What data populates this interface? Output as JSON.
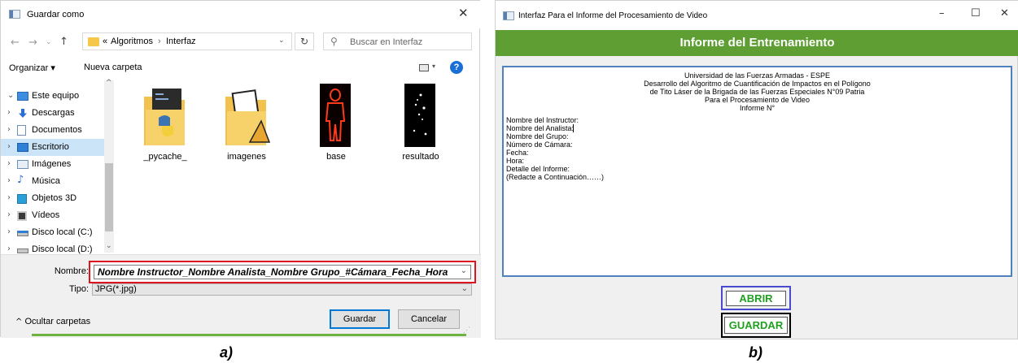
{
  "save_dialog": {
    "title": "Guardar como",
    "address": {
      "prefix": "«",
      "path1": "Algoritmos",
      "sep": "›",
      "path2": "Interfaz"
    },
    "search_placeholder": "Buscar en Interfaz",
    "toolbar": {
      "organize": "Organizar ▾",
      "new_folder": "Nueva carpeta"
    },
    "sidebar": [
      {
        "label": "Este equipo",
        "icon": "computer-icon",
        "chev": "⌄"
      },
      {
        "label": "Descargas",
        "icon": "download-icon",
        "chev": "›"
      },
      {
        "label": "Documentos",
        "icon": "documents-icon",
        "chev": "›"
      },
      {
        "label": "Escritorio",
        "icon": "desktop-icon",
        "chev": "›",
        "selected": true
      },
      {
        "label": "Imágenes",
        "icon": "pictures-icon",
        "chev": "›"
      },
      {
        "label": "Música",
        "icon": "music-icon",
        "chev": "›"
      },
      {
        "label": "Objetos 3D",
        "icon": "3d-objects-icon",
        "chev": "›"
      },
      {
        "label": "Vídeos",
        "icon": "videos-icon",
        "chev": "›"
      },
      {
        "label": "Disco local (C:)",
        "icon": "drive-c-icon",
        "chev": "›"
      },
      {
        "label": "Disco local (D:)",
        "icon": "drive-d-icon",
        "chev": "›"
      }
    ],
    "files": [
      {
        "name": "_pycache_",
        "icon": "python-folder-icon"
      },
      {
        "name": "imagenes",
        "icon": "images-folder-icon"
      },
      {
        "name": "base",
        "icon": "base-image-icon"
      },
      {
        "name": "resultado",
        "icon": "result-image-icon"
      }
    ],
    "name_label": "Nombre:",
    "name_value": "Nombre Instructor_Nombre Analista_Nombre Grupo_#Cámara_Fecha_Hora",
    "type_label": "Tipo:",
    "type_value": "JPG(*.jpg)",
    "save_button": "Guardar",
    "cancel_button": "Cancelar",
    "hide_folders": "Ocultar carpetas"
  },
  "report_window": {
    "title": "Interfaz Para el Informe del Procesamiento de Video",
    "banner": "Informe del Entrenamiento",
    "header_lines": [
      "Universidad de las Fuerzas Armadas - ESPE",
      "Desarrollo del Algoritmo de Cuantificación de Impactos en el Polígono",
      "de Tito Láser de la Brigada de las Fuerzas Especiales N°09 Patria",
      "Para el Procesamiento de Video",
      "Informe N°"
    ],
    "field_lines": [
      "Nombre del Instructor:",
      "Nombre del Analista:",
      "Nombre del Grupo:",
      "Número de Cámara:",
      "Fecha:",
      "Hora:",
      "Detalle del Informe:",
      "(Redacte a Continuación……)"
    ],
    "open_button": "ABRIR",
    "save_button": "GUARDAR"
  },
  "captions": {
    "a": "a)",
    "b": "b)"
  },
  "colors": {
    "banner": "#5e9e33",
    "button_text": "#20a020",
    "red_highlight": "#e0141e",
    "blue_frame": "#4a4ad0"
  }
}
